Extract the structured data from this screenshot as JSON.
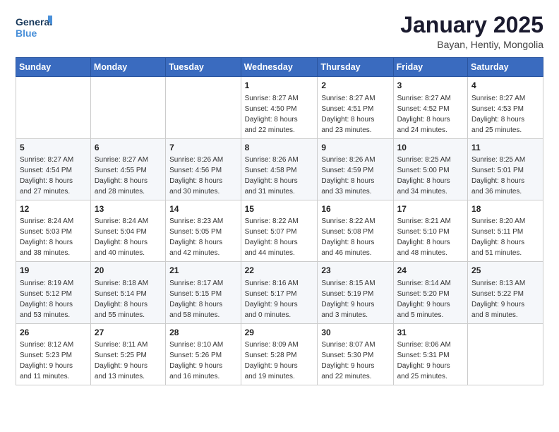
{
  "header": {
    "logo_line1": "General",
    "logo_line2": "Blue",
    "month": "January 2025",
    "location": "Bayan, Hentiy, Mongolia"
  },
  "weekdays": [
    "Sunday",
    "Monday",
    "Tuesday",
    "Wednesday",
    "Thursday",
    "Friday",
    "Saturday"
  ],
  "weeks": [
    [
      {
        "day": "",
        "info": ""
      },
      {
        "day": "",
        "info": ""
      },
      {
        "day": "",
        "info": ""
      },
      {
        "day": "1",
        "info": "Sunrise: 8:27 AM\nSunset: 4:50 PM\nDaylight: 8 hours\nand 22 minutes."
      },
      {
        "day": "2",
        "info": "Sunrise: 8:27 AM\nSunset: 4:51 PM\nDaylight: 8 hours\nand 23 minutes."
      },
      {
        "day": "3",
        "info": "Sunrise: 8:27 AM\nSunset: 4:52 PM\nDaylight: 8 hours\nand 24 minutes."
      },
      {
        "day": "4",
        "info": "Sunrise: 8:27 AM\nSunset: 4:53 PM\nDaylight: 8 hours\nand 25 minutes."
      }
    ],
    [
      {
        "day": "5",
        "info": "Sunrise: 8:27 AM\nSunset: 4:54 PM\nDaylight: 8 hours\nand 27 minutes."
      },
      {
        "day": "6",
        "info": "Sunrise: 8:27 AM\nSunset: 4:55 PM\nDaylight: 8 hours\nand 28 minutes."
      },
      {
        "day": "7",
        "info": "Sunrise: 8:26 AM\nSunset: 4:56 PM\nDaylight: 8 hours\nand 30 minutes."
      },
      {
        "day": "8",
        "info": "Sunrise: 8:26 AM\nSunset: 4:58 PM\nDaylight: 8 hours\nand 31 minutes."
      },
      {
        "day": "9",
        "info": "Sunrise: 8:26 AM\nSunset: 4:59 PM\nDaylight: 8 hours\nand 33 minutes."
      },
      {
        "day": "10",
        "info": "Sunrise: 8:25 AM\nSunset: 5:00 PM\nDaylight: 8 hours\nand 34 minutes."
      },
      {
        "day": "11",
        "info": "Sunrise: 8:25 AM\nSunset: 5:01 PM\nDaylight: 8 hours\nand 36 minutes."
      }
    ],
    [
      {
        "day": "12",
        "info": "Sunrise: 8:24 AM\nSunset: 5:03 PM\nDaylight: 8 hours\nand 38 minutes."
      },
      {
        "day": "13",
        "info": "Sunrise: 8:24 AM\nSunset: 5:04 PM\nDaylight: 8 hours\nand 40 minutes."
      },
      {
        "day": "14",
        "info": "Sunrise: 8:23 AM\nSunset: 5:05 PM\nDaylight: 8 hours\nand 42 minutes."
      },
      {
        "day": "15",
        "info": "Sunrise: 8:22 AM\nSunset: 5:07 PM\nDaylight: 8 hours\nand 44 minutes."
      },
      {
        "day": "16",
        "info": "Sunrise: 8:22 AM\nSunset: 5:08 PM\nDaylight: 8 hours\nand 46 minutes."
      },
      {
        "day": "17",
        "info": "Sunrise: 8:21 AM\nSunset: 5:10 PM\nDaylight: 8 hours\nand 48 minutes."
      },
      {
        "day": "18",
        "info": "Sunrise: 8:20 AM\nSunset: 5:11 PM\nDaylight: 8 hours\nand 51 minutes."
      }
    ],
    [
      {
        "day": "19",
        "info": "Sunrise: 8:19 AM\nSunset: 5:12 PM\nDaylight: 8 hours\nand 53 minutes."
      },
      {
        "day": "20",
        "info": "Sunrise: 8:18 AM\nSunset: 5:14 PM\nDaylight: 8 hours\nand 55 minutes."
      },
      {
        "day": "21",
        "info": "Sunrise: 8:17 AM\nSunset: 5:15 PM\nDaylight: 8 hours\nand 58 minutes."
      },
      {
        "day": "22",
        "info": "Sunrise: 8:16 AM\nSunset: 5:17 PM\nDaylight: 9 hours\nand 0 minutes."
      },
      {
        "day": "23",
        "info": "Sunrise: 8:15 AM\nSunset: 5:19 PM\nDaylight: 9 hours\nand 3 minutes."
      },
      {
        "day": "24",
        "info": "Sunrise: 8:14 AM\nSunset: 5:20 PM\nDaylight: 9 hours\nand 5 minutes."
      },
      {
        "day": "25",
        "info": "Sunrise: 8:13 AM\nSunset: 5:22 PM\nDaylight: 9 hours\nand 8 minutes."
      }
    ],
    [
      {
        "day": "26",
        "info": "Sunrise: 8:12 AM\nSunset: 5:23 PM\nDaylight: 9 hours\nand 11 minutes."
      },
      {
        "day": "27",
        "info": "Sunrise: 8:11 AM\nSunset: 5:25 PM\nDaylight: 9 hours\nand 13 minutes."
      },
      {
        "day": "28",
        "info": "Sunrise: 8:10 AM\nSunset: 5:26 PM\nDaylight: 9 hours\nand 16 minutes."
      },
      {
        "day": "29",
        "info": "Sunrise: 8:09 AM\nSunset: 5:28 PM\nDaylight: 9 hours\nand 19 minutes."
      },
      {
        "day": "30",
        "info": "Sunrise: 8:07 AM\nSunset: 5:30 PM\nDaylight: 9 hours\nand 22 minutes."
      },
      {
        "day": "31",
        "info": "Sunrise: 8:06 AM\nSunset: 5:31 PM\nDaylight: 9 hours\nand 25 minutes."
      },
      {
        "day": "",
        "info": ""
      }
    ]
  ]
}
